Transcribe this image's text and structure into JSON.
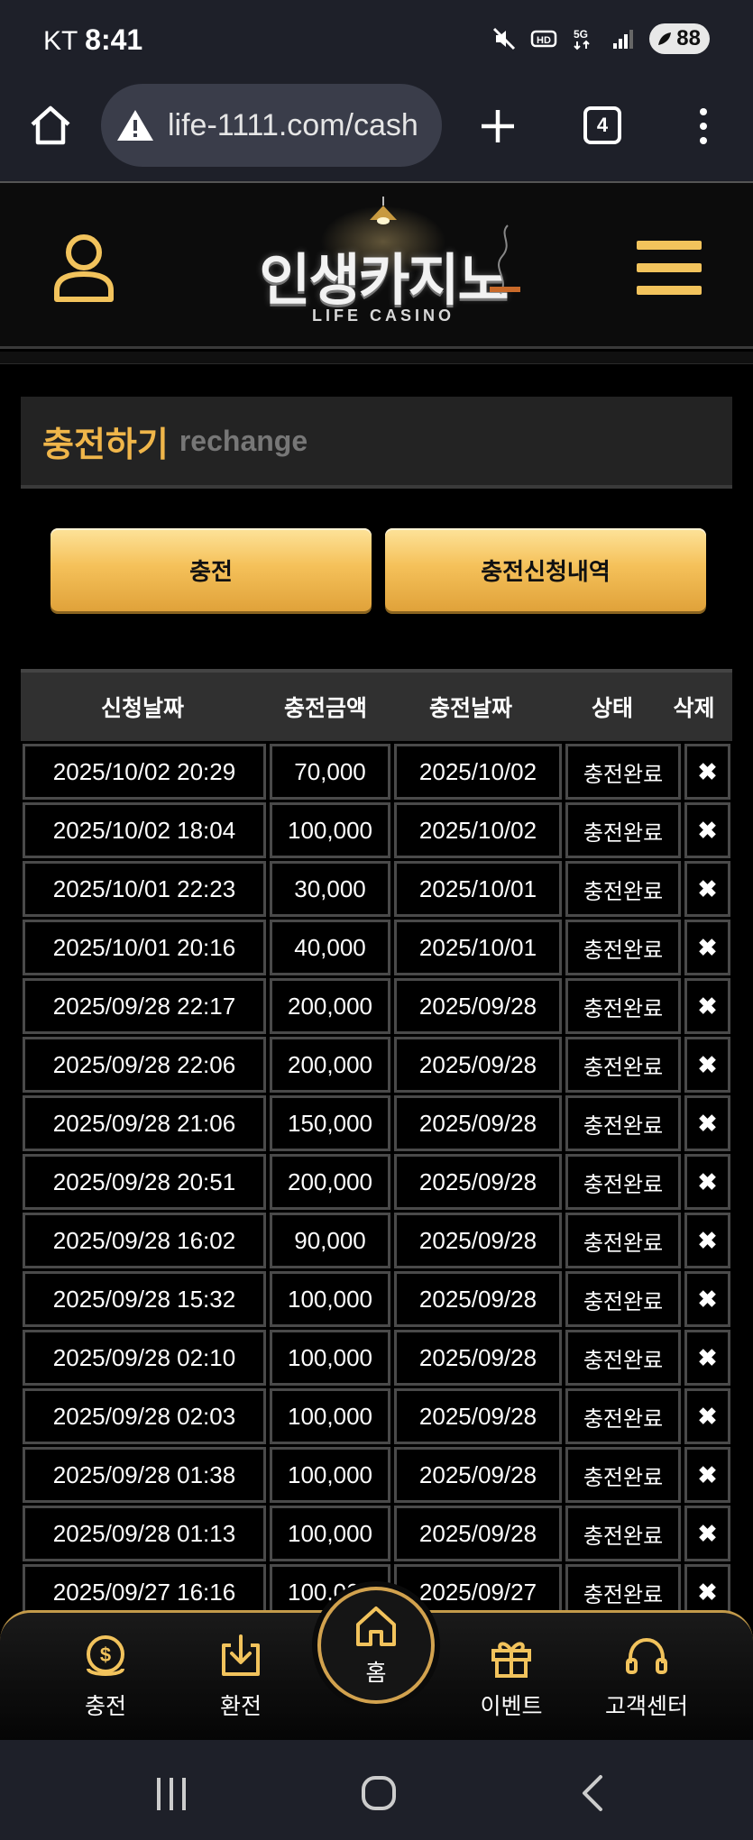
{
  "status_bar": {
    "carrier": "KT",
    "time": "8:41",
    "battery": "88"
  },
  "browser": {
    "url": "life-1111.com/cash",
    "tab_count": "4"
  },
  "header": {
    "logo_ko": "인생카지노",
    "logo_en": "LIFE CASINO"
  },
  "section": {
    "title_ko": "충전하기",
    "title_en": "rechange"
  },
  "buttons": {
    "charge": "충전",
    "history": "충전신청내역"
  },
  "table": {
    "headers": [
      "신청날짜",
      "충전금액",
      "충전날짜",
      "상태",
      "삭제"
    ],
    "rows": [
      [
        "2025/10/02 20:29",
        "70,000",
        "2025/10/02",
        "충전완료"
      ],
      [
        "2025/10/02 18:04",
        "100,000",
        "2025/10/02",
        "충전완료"
      ],
      [
        "2025/10/01 22:23",
        "30,000",
        "2025/10/01",
        "충전완료"
      ],
      [
        "2025/10/01 20:16",
        "40,000",
        "2025/10/01",
        "충전완료"
      ],
      [
        "2025/09/28 22:17",
        "200,000",
        "2025/09/28",
        "충전완료"
      ],
      [
        "2025/09/28 22:06",
        "200,000",
        "2025/09/28",
        "충전완료"
      ],
      [
        "2025/09/28 21:06",
        "150,000",
        "2025/09/28",
        "충전완료"
      ],
      [
        "2025/09/28 20:51",
        "200,000",
        "2025/09/28",
        "충전완료"
      ],
      [
        "2025/09/28 16:02",
        "90,000",
        "2025/09/28",
        "충전완료"
      ],
      [
        "2025/09/28 15:32",
        "100,000",
        "2025/09/28",
        "충전완료"
      ],
      [
        "2025/09/28 02:10",
        "100,000",
        "2025/09/28",
        "충전완료"
      ],
      [
        "2025/09/28 02:03",
        "100,000",
        "2025/09/28",
        "충전완료"
      ],
      [
        "2025/09/28 01:38",
        "100,000",
        "2025/09/28",
        "충전완료"
      ],
      [
        "2025/09/28 01:13",
        "100,000",
        "2025/09/28",
        "충전완료"
      ],
      [
        "2025/09/27 16:16",
        "100,000",
        "2025/09/27",
        "충전완료"
      ]
    ],
    "delete_symbol": "✖"
  },
  "bottom_nav": {
    "charge": "충전",
    "exchange": "환전",
    "home": "홈",
    "event": "이벤트",
    "support": "고객센터"
  },
  "colors": {
    "accent": "#f0b64a",
    "button_gold": "#f5c15a",
    "nav_border": "#c39a4a"
  }
}
